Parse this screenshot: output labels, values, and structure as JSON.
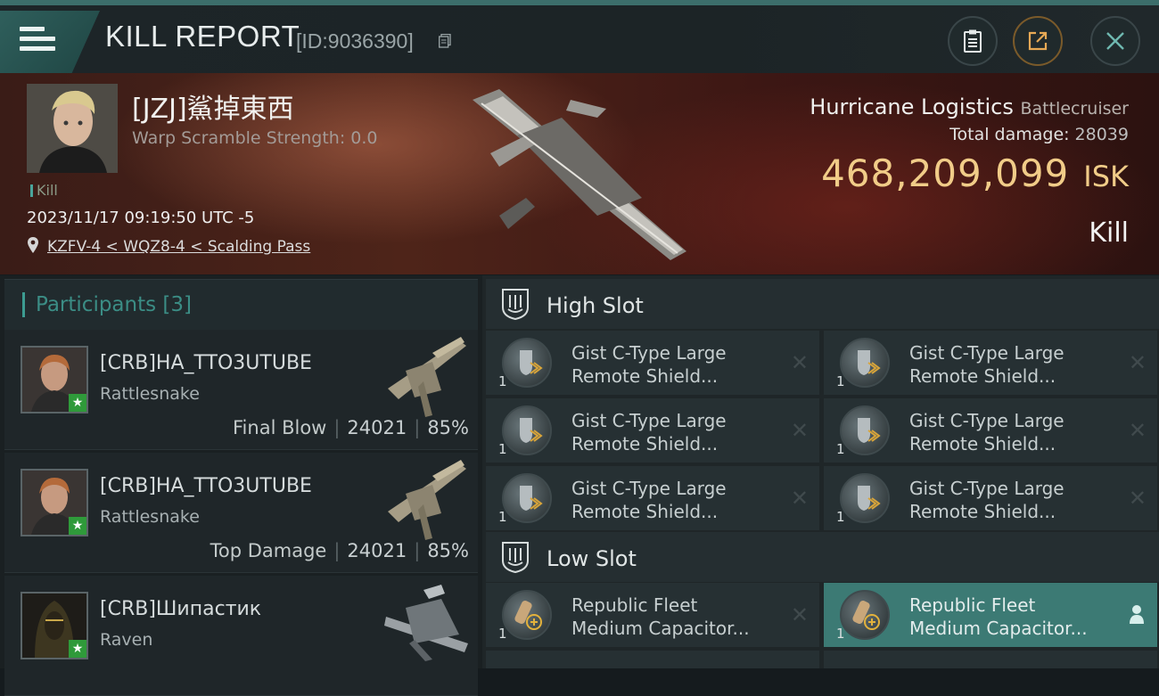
{
  "header": {
    "title": "KILL REPORT",
    "report_id": "[ID:9036390]"
  },
  "victim": {
    "name": "[JZJ]鯊掉東西",
    "warp_scramble": "Warp Scramble Strength: 0.0",
    "kill_tag": "Kill",
    "datetime": "2023/11/17 09:19:50 UTC -5",
    "location": "KZFV-4 < WQZ8-4 < Scalding Pass",
    "ship_name": "Hurricane Logistics",
    "ship_class": "Battlecruiser",
    "total_damage_label": "Total damage:",
    "total_damage_value": "28039",
    "isk_value": "468,209,099",
    "isk_currency": "ISK",
    "kill_type": "Kill"
  },
  "participants": {
    "header": "Participants [3]",
    "rows": [
      {
        "name": "[CRB]HA_TTO3UTUBE",
        "ship": "Rattlesnake",
        "role": "Final Blow",
        "damage": "24021",
        "percent": "85%"
      },
      {
        "name": "[CRB]HA_TTO3UTUBE",
        "ship": "Rattlesnake",
        "role": "Top Damage",
        "damage": "24021",
        "percent": "85%"
      },
      {
        "name": "[CRB]Шипастик",
        "ship": "Raven",
        "role": "",
        "damage": "",
        "percent": ""
      }
    ]
  },
  "fitting": {
    "high_slot": {
      "label": "High Slot",
      "modules": [
        {
          "line1": "Gist C-Type Large",
          "line2": "Remote Shield...",
          "qty": "1"
        },
        {
          "line1": "Gist C-Type Large",
          "line2": "Remote Shield...",
          "qty": "1"
        },
        {
          "line1": "Gist C-Type Large",
          "line2": "Remote Shield...",
          "qty": "1"
        },
        {
          "line1": "Gist C-Type Large",
          "line2": "Remote Shield...",
          "qty": "1"
        },
        {
          "line1": "Gist C-Type Large",
          "line2": "Remote Shield...",
          "qty": "1"
        },
        {
          "line1": "Gist C-Type Large",
          "line2": "Remote Shield...",
          "qty": "1"
        }
      ]
    },
    "low_slot": {
      "label": "Low Slot",
      "modules": [
        {
          "line1": "Republic Fleet",
          "line2": "Medium Capacitor...",
          "qty": "1"
        },
        {
          "line1": "Republic Fleet",
          "line2": "Medium Capacitor...",
          "qty": "1"
        }
      ]
    }
  },
  "colors": {
    "accent_teal": "#3c9c91",
    "isk_gold": "#f1cc88",
    "selected_module": "#3c7a74"
  }
}
